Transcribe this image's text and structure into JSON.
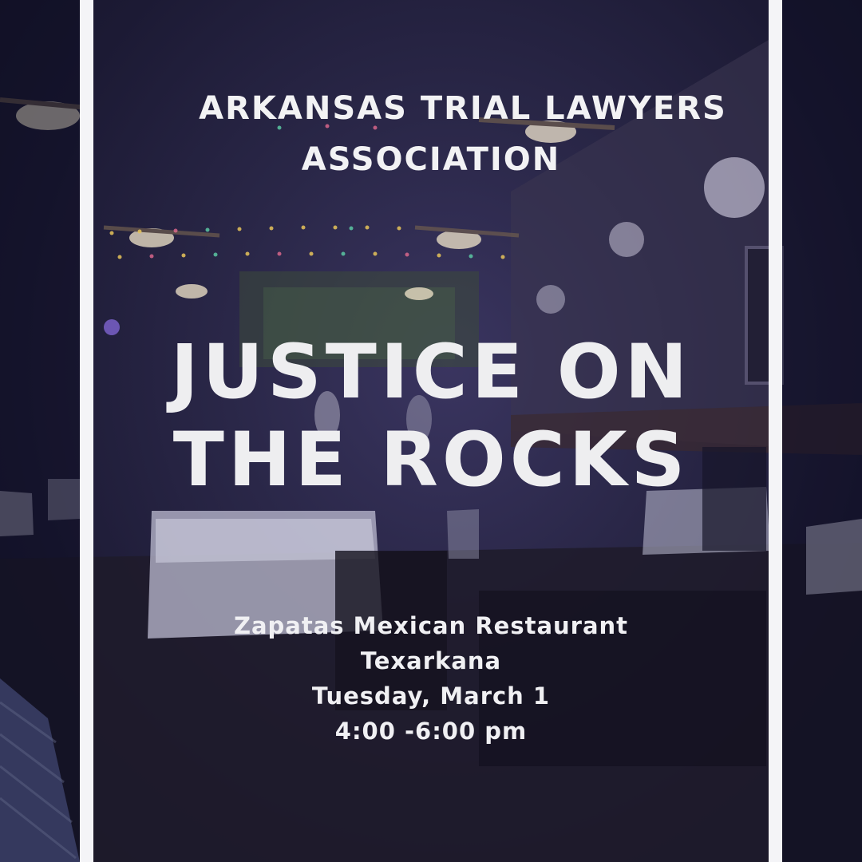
{
  "organization": {
    "line1": "ARKANSAS TRIAL LAWYERS",
    "line2": "ASSOCIATION"
  },
  "headline": {
    "line1": "JUSTICE ON",
    "line2": "THE ROCKS"
  },
  "details": {
    "venue": "Zapatas Mexican Restaurant",
    "city": "Texarkana",
    "date": "Tuesday, March 1",
    "time": "4:00 -6:00 pm"
  },
  "colors": {
    "overlay": "#1c1a34",
    "stripe": "#f4f4f7",
    "text": "#f0f0f3"
  }
}
